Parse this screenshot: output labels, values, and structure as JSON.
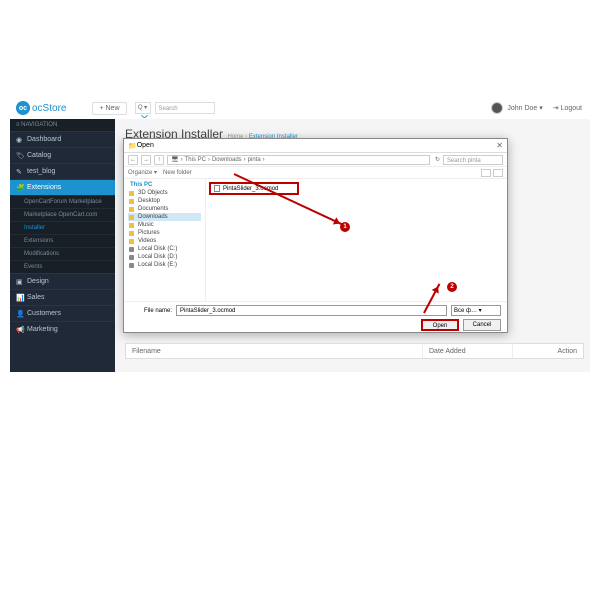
{
  "brand": {
    "logo_text": "ocStore",
    "logo_icon": "oc"
  },
  "topbar": {
    "new_btn": "+ New",
    "q": "Q ▾",
    "search_placeholder": "Search",
    "user": "John Doe ▾",
    "logout": "⇥ Logout"
  },
  "sidebar": {
    "header": "≡ NAVIGATION",
    "items": [
      {
        "icon": "◉",
        "label": "Dashboard"
      },
      {
        "icon": "🏷",
        "label": "Catalog"
      },
      {
        "icon": "✎",
        "label": "test_blog"
      },
      {
        "icon": "🧩",
        "label": "Extensions",
        "active": true
      },
      {
        "icon": "▣",
        "label": "Design"
      },
      {
        "icon": "📊",
        "label": "Sales"
      },
      {
        "icon": "👤",
        "label": "Customers"
      },
      {
        "icon": "📢",
        "label": "Marketing"
      }
    ],
    "subs": [
      {
        "label": "OpenCartForum Marketplace"
      },
      {
        "label": "Marketplace OpenCart.com"
      },
      {
        "label": "Installer",
        "sel": true
      },
      {
        "label": "Extensions"
      },
      {
        "label": "Modifications"
      },
      {
        "label": "Events"
      }
    ]
  },
  "page": {
    "title": "Extension Installer",
    "crumb_home": "Home",
    "crumb_sep": " › ",
    "crumb_cur": "Extension Installer"
  },
  "dialog": {
    "title": "Open",
    "close": "✕",
    "nav_back": "←",
    "nav_fwd": "→",
    "nav_up": "↑",
    "path_parts": [
      "This PC",
      "Downloads",
      "pinta"
    ],
    "path_sep": " › ",
    "search_placeholder": "Search pinta",
    "refresh": "↻",
    "organize": "Organize ▾",
    "newfolder": "New folder",
    "tree": [
      {
        "label": "This PC",
        "root": true
      },
      {
        "label": "3D Objects"
      },
      {
        "label": "Desktop"
      },
      {
        "label": "Documents"
      },
      {
        "label": "Downloads",
        "sel": true
      },
      {
        "label": "Music"
      },
      {
        "label": "Pictures"
      },
      {
        "label": "Videos"
      },
      {
        "label": "Local Disk (C:)",
        "disk": true
      },
      {
        "label": "Local Disk (D:)",
        "disk": true
      },
      {
        "label": "Local Disk (E:)",
        "disk": true
      }
    ],
    "file": "PintaSlider_3.ocmod",
    "file_label": "File name:",
    "file_value": "PintaSlider_3.ocmod",
    "filter": "Все ф… ▾",
    "open": "Open",
    "cancel": "Cancel"
  },
  "markers": {
    "m1": "1",
    "m2": "2"
  },
  "table": {
    "c1": "Filename",
    "c2": "Date Added",
    "c3": "Action"
  }
}
